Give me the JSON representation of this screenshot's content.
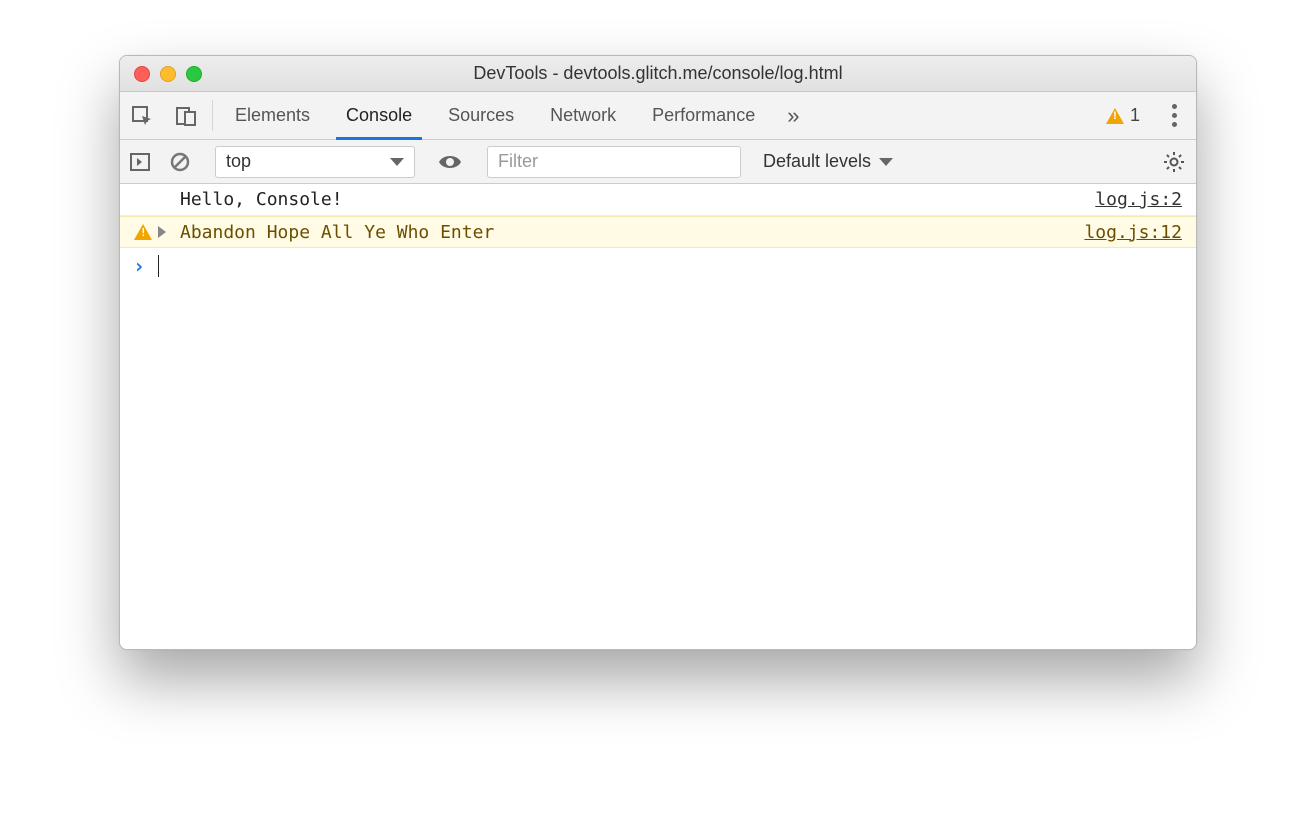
{
  "window": {
    "title": "DevTools - devtools.glitch.me/console/log.html"
  },
  "tabs": {
    "items": [
      "Elements",
      "Console",
      "Sources",
      "Network",
      "Performance"
    ],
    "active_index": 1,
    "more_label": "»"
  },
  "warning_badge": {
    "count": "1"
  },
  "toolbar": {
    "context": "top",
    "filter_placeholder": "Filter",
    "levels_label": "Default levels"
  },
  "console": {
    "rows": [
      {
        "type": "log",
        "message": "Hello, Console!",
        "source": "log.js:2"
      },
      {
        "type": "warning",
        "message": "Abandon Hope All Ye Who Enter",
        "source": "log.js:12"
      }
    ],
    "prompt": "›"
  }
}
